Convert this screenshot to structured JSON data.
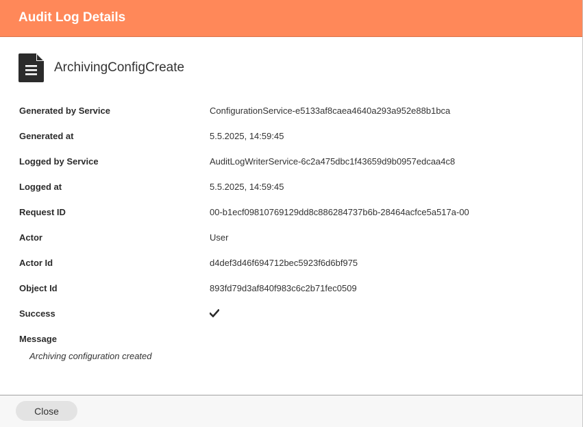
{
  "dialog": {
    "title": "Audit Log Details"
  },
  "object": {
    "icon": "document-icon",
    "name": "ArchivingConfigCreate"
  },
  "fields": [
    {
      "label": "Generated by Service",
      "value": "ConfigurationService-e5133af8caea4640a293a952e88b1bca"
    },
    {
      "label": "Generated at",
      "value": "5.5.2025, 14:59:45"
    },
    {
      "label": "Logged by Service",
      "value": "AuditLogWriterService-6c2a475dbc1f43659d9b0957edcaa4c8"
    },
    {
      "label": "Logged at",
      "value": "5.5.2025, 14:59:45"
    },
    {
      "label": "Request ID",
      "value": "00-b1ecf09810769129dd8c886284737b6b-28464acfce5a517a-00"
    },
    {
      "label": "Actor",
      "value": "User"
    },
    {
      "label": "Actor Id",
      "value": "d4def3d46f694712bec5923f6d6bf975"
    },
    {
      "label": "Object Id",
      "value": "893fd79d3af840f983c6c2b71fec0509"
    },
    {
      "label": "Success",
      "value_icon": "checkmark-icon"
    }
  ],
  "message": {
    "label": "Message",
    "text": "Archiving configuration created"
  },
  "footer": {
    "close_label": "Close"
  },
  "colors": {
    "header_bg": "#ff8859",
    "header_text": "#ffffff",
    "button_bg": "#e3e3e3"
  }
}
